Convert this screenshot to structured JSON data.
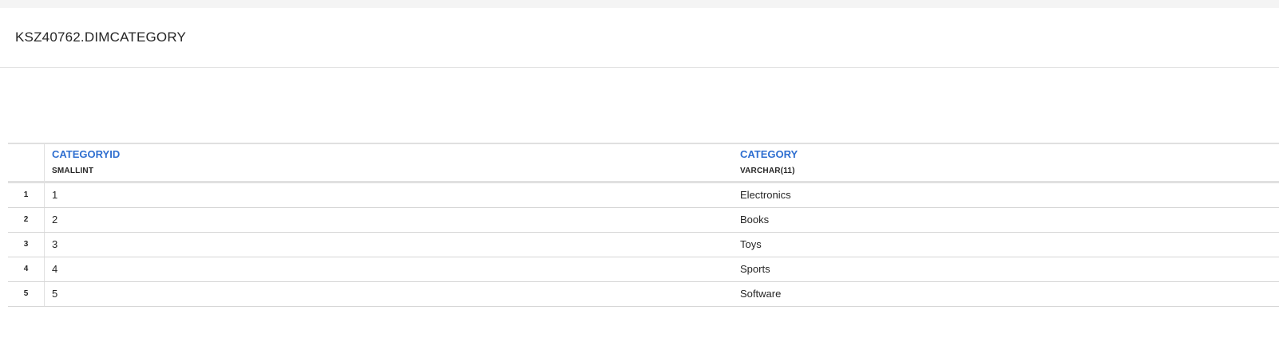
{
  "title": "KSZ40762.DIMCATEGORY",
  "columns": [
    {
      "name": "CATEGORYID",
      "type": "SMALLINT"
    },
    {
      "name": "CATEGORY",
      "type": "VARCHAR(11)"
    }
  ],
  "rows": [
    {
      "num": "1",
      "id": "1",
      "category": "Electronics"
    },
    {
      "num": "2",
      "id": "2",
      "category": "Books"
    },
    {
      "num": "3",
      "id": "3",
      "category": "Toys"
    },
    {
      "num": "4",
      "id": "4",
      "category": "Sports"
    },
    {
      "num": "5",
      "id": "5",
      "category": "Software"
    }
  ],
  "colors": {
    "header_link": "#2f6fd0",
    "border": "#e0e0e0",
    "top_strip": "#f4f4f4"
  }
}
